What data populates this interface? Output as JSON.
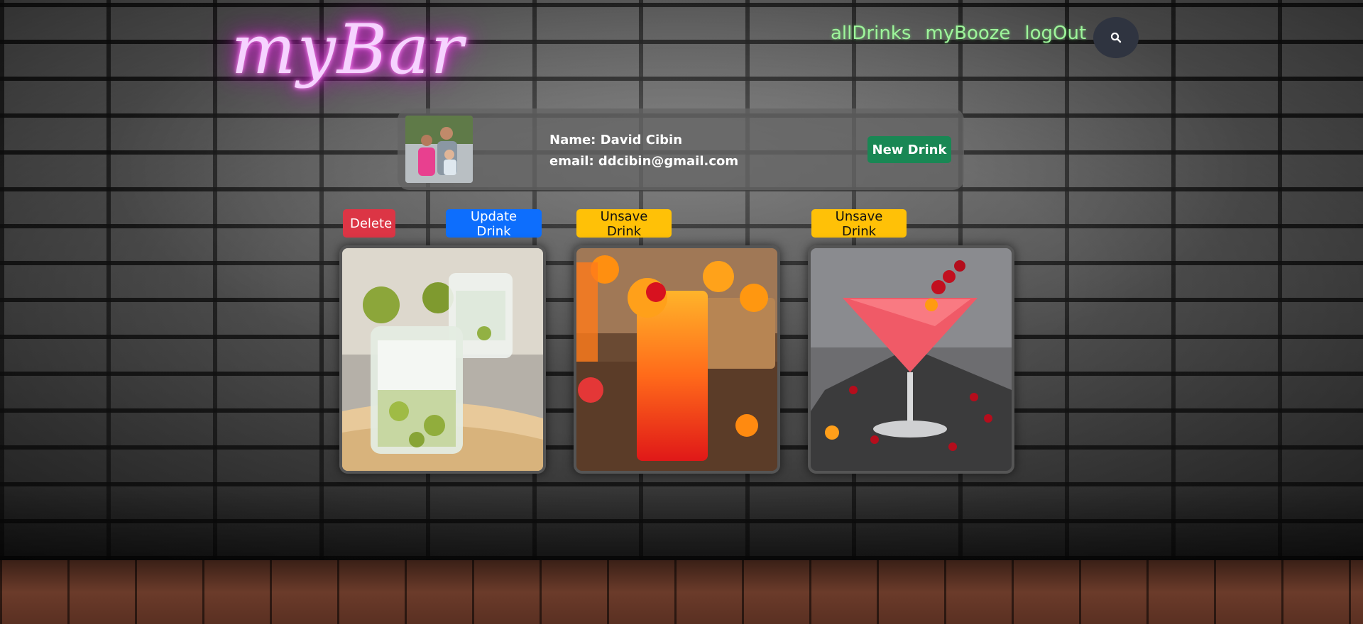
{
  "app": {
    "logo": "myBar"
  },
  "nav": {
    "items": [
      "allDrinks",
      "myBooze",
      "logOut"
    ]
  },
  "icons": {
    "search": "search-icon"
  },
  "profile": {
    "name_line": "Name: David Cibin",
    "email_line": "email: ddcibin@gmail.com",
    "new_drink_label": "New Drink"
  },
  "actions": {
    "delete": "Delete",
    "update": "Update Drink",
    "unsave_1": "Unsave Drink",
    "unsave_2": "Unsave Drink"
  },
  "colors": {
    "neon_pink": "#f6d3ff",
    "nav_green": "#9ef59b",
    "new_drink": "#198754",
    "delete": "#dc3545",
    "update": "#0d6efd",
    "unsave": "#ffc107"
  }
}
